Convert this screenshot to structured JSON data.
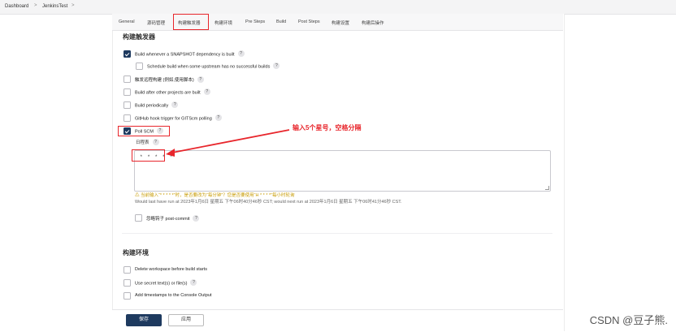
{
  "breadcrumb": {
    "items": [
      "Dashboard",
      "JenkinsTest"
    ],
    "separator": ">"
  },
  "tabs": [
    "General",
    "源码管理",
    "构建触发器",
    "构建环境",
    "Pre Steps",
    "Build",
    "Post Steps",
    "构建设置",
    "构建后操作"
  ],
  "triggers": {
    "heading": "构建触发器",
    "items": [
      {
        "label": "Build whenever a SNAPSHOT dependency is built",
        "checked": true
      },
      {
        "label": "Schedule build when some upstream has no successful builds",
        "checked": false
      },
      {
        "label": "触发远程构建 (例如,使用脚本)",
        "checked": false
      },
      {
        "label": "Build after other projects are built",
        "checked": false
      },
      {
        "label": "Build periodically",
        "checked": false
      },
      {
        "label": "GitHub hook trigger for GITScm polling",
        "checked": false
      },
      {
        "label": "Poll SCM",
        "checked": true
      }
    ],
    "schedule_label": "日程表",
    "schedule_value": "* * * * *",
    "warning": "⚠ 当前输入“* * * * *”时，是否要改为“每分钟”？您是否要使用“H * * * *”每小时轮询",
    "note": "Would last have run at 2023年1月6日 星期五 下午06时40分46秒 CST; would next run at 2023年1月6日 星期五 下午06时41分46秒 CST.",
    "ignore_hook_label": "忽略钩子 post-commit"
  },
  "env": {
    "heading": "构建环境",
    "items": [
      {
        "label": "Delete workspace before build starts",
        "checked": false
      },
      {
        "label": "Use secret text(s) or file(s)",
        "checked": false
      },
      {
        "label": "Add timestamps to the Console Output",
        "checked": false
      }
    ]
  },
  "help_glyph": "?",
  "annotation": {
    "text": "输入5个星号，空格分隔",
    "color": "#e8262c"
  },
  "buttons": {
    "save": "保存",
    "apply": "应用"
  },
  "watermark": "CSDN @豆子熊.",
  "colors": {
    "primary": "#1e3a5f",
    "annotation_red": "#e8262c",
    "warning": "#c79a00"
  }
}
